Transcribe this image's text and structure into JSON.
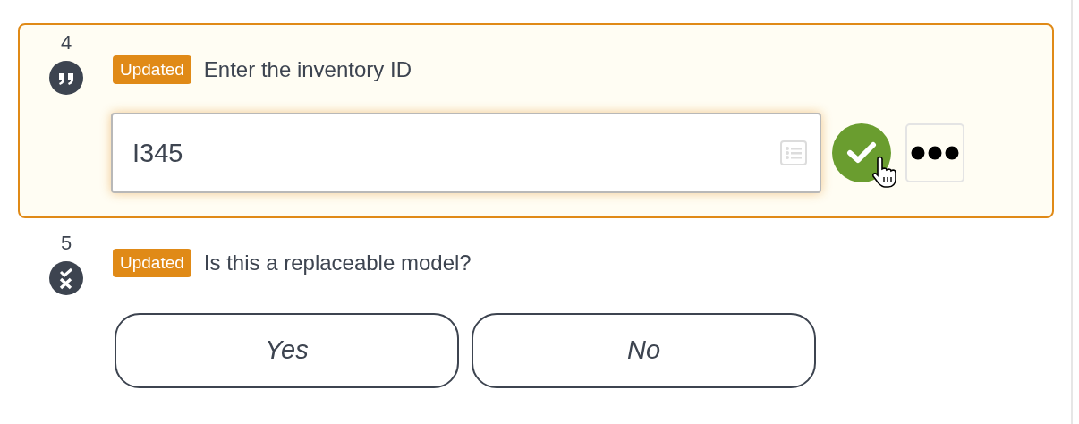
{
  "questions": [
    {
      "number": "4",
      "kind": "text",
      "active": true,
      "badge": "Updated",
      "prompt": "Enter the inventory ID",
      "value": "I345"
    },
    {
      "number": "5",
      "kind": "yes_no",
      "badge": "Updated",
      "prompt": "Is this a replaceable model?",
      "options": [
        {
          "label": "Yes",
          "selected": false
        },
        {
          "label": "No",
          "selected": false
        }
      ]
    }
  ]
}
